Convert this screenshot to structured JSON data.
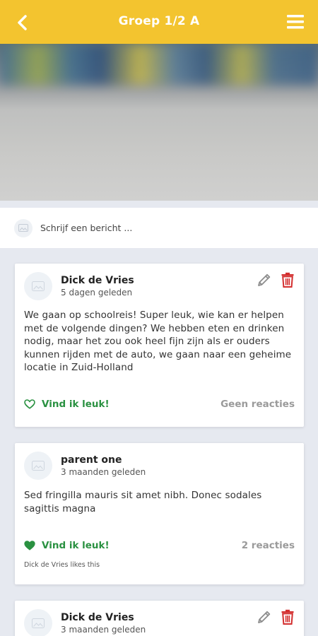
{
  "header": {
    "title": "Groep 1/2 A",
    "back_icon": "chevron-left-icon",
    "menu_icon": "hamburger-menu-icon",
    "color": "#f3c42f"
  },
  "composer": {
    "placeholder": "Schrijf een bericht ..."
  },
  "posts": [
    {
      "author": "Dick de Vries",
      "time": "5 dagen geleden",
      "body": "We gaan op schoolreis! Super leuk, wie kan er helpen met de volgende dingen? We hebben eten en drinken nodig, maar het zou ook heel fijn zijn als er ouders kunnen rijden met de auto, we gaan naar een geheime locatie in Zuid-Holland",
      "like_label": "Vind ik leuk!",
      "liked": false,
      "reactions": "Geen reacties",
      "can_edit": true
    },
    {
      "author": "parent one",
      "time": "3 maanden geleden",
      "body": "Sed fringilla mauris sit amet nibh. Donec sodales sagittis magna",
      "like_label": "Vind ik leuk!",
      "liked": true,
      "reactions": "2 reacties",
      "likes_text": "Dick de Vries likes this",
      "can_edit": false
    },
    {
      "author": "Dick de Vries",
      "time": "3 maanden geleden",
      "can_edit": true
    }
  ],
  "colors": {
    "accent": "#f3c42f",
    "like": "#2a9141",
    "delete": "#d32f2f"
  }
}
